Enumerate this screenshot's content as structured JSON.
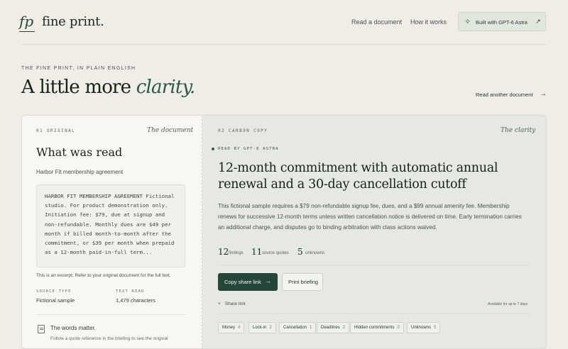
{
  "header": {
    "logo_mark": "fp",
    "logo_text": "fine print.",
    "nav": [
      "Read a document",
      "How it works"
    ],
    "built_with_label": "Built with GPT-6 Astra",
    "built_with_icon": "sparkle-icon",
    "built_with_arrow": "↗"
  },
  "hero": {
    "eyebrow": "THE FINE PRINT, IN PLAIN ENGLISH",
    "headline_prefix": "A little more ",
    "headline_emphasis": "clarity.",
    "read_another": "Read another document",
    "read_another_arrow": "→"
  },
  "original": {
    "tag": "01   ORIGINAL",
    "caption": "The document",
    "title": "What was read",
    "subtitle": "Harbor Fit membership agreement",
    "excerpt": "HARBOR FIT MEMBERSHIP AGREEMENT Fictional studio. For product demonstration only. Initiation fee: $79, due at signup and non-refundable. Monthly dues are $49 per month if billed month-to-month after the commitment, or $39 per month when prepaid as a 12-month paid-in-full term...",
    "note": "This is an excerpt. Refer to your original document for the full text.",
    "source_type_label": "SOURCE TYPE",
    "source_type": "Fictional sample",
    "text_read_label": "TEXT READ",
    "text_read": "1,479 characters",
    "words_title": "The words matter.",
    "words_sub": "Follow a quote reference in the briefing to see the original"
  },
  "clarity": {
    "tag": "02   CARBON COPY",
    "caption": "The clarity",
    "badge": "READ BY GPT-6 ASTRA",
    "title": "12-month commitment with automatic annual renewal and a 30-day cancellation cutoff",
    "summary": "This fictional sample requires a $79 non-refundable signup fee, dues, and a $99 annual amenity fee. Membership renews for successive 12-month terms unless written cancellation notice is delivered on time. Early termination carries an additional charge, and disputes go to binding arbitration with class actions waived.",
    "stats": [
      {
        "num": "12",
        "label": "findings"
      },
      {
        "num": "11",
        "label": "source quotes"
      },
      {
        "num": "5",
        "label": "unknowns"
      }
    ],
    "copy_link": "Copy share link",
    "copy_link_arrow": "→",
    "print": "Print briefing",
    "share_plus": "+",
    "share_link": "Share link",
    "availability": "Available for up to 7 days",
    "chips": [
      {
        "label": "Money",
        "count": "4"
      },
      {
        "label": "Lock-in",
        "count": "2"
      },
      {
        "label": "Cancellation",
        "count": "1"
      },
      {
        "label": "Deadlines",
        "count": "2"
      },
      {
        "label": "Hidden commitments",
        "count": "3"
      },
      {
        "label": "Unknowns",
        "count": "5"
      }
    ]
  },
  "colors": {
    "background": "#efede6",
    "accent": "#24473a",
    "accent_text": "#2a5a44"
  }
}
